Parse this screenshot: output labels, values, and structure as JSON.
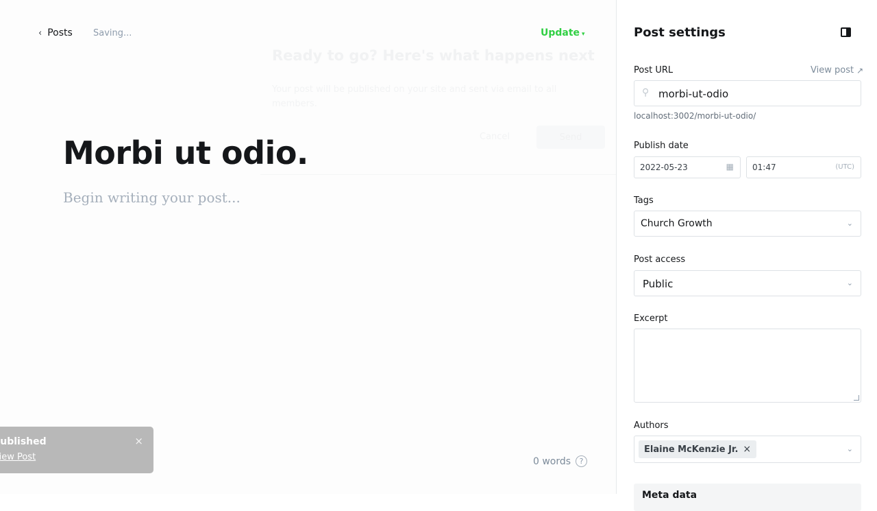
{
  "topbar": {
    "back_label": "Posts",
    "status": "Saving...",
    "update_label": "Update"
  },
  "ghost_modal": {
    "title": "Ready to go? Here's what happens next",
    "description": "Your post will be published on your site and sent via email to all members.",
    "cancel_label": "Cancel",
    "send_label": "Send"
  },
  "post": {
    "title": "Morbi ut odio.",
    "body_placeholder": "Begin writing your post..."
  },
  "toast": {
    "title": "Published",
    "link": "View Post",
    "close": "×"
  },
  "footer": {
    "word_count": "0 words",
    "help": "?"
  },
  "settings": {
    "title": "Post settings",
    "url_label": "Post URL",
    "view_post": "View post",
    "url_value": "morbi-ut-odio",
    "url_hint": "localhost:3002/morbi-ut-odio/",
    "publish_label": "Publish date",
    "date_value": "2022-05-23",
    "time_value": "01:47",
    "timezone": "(UTC)",
    "tags_label": "Tags",
    "tags_value": "Church Growth",
    "access_label": "Post access",
    "access_value": "Public",
    "excerpt_label": "Excerpt",
    "excerpt_value": "",
    "authors_label": "Authors",
    "author_name": "Elaine McKenzie Jr.",
    "next_section": "Meta data"
  },
  "colors": {
    "accent_green": "#30cf43",
    "text_dark": "#15171a",
    "muted": "#8e9cac",
    "toast_bg": "#b8b8b8"
  }
}
